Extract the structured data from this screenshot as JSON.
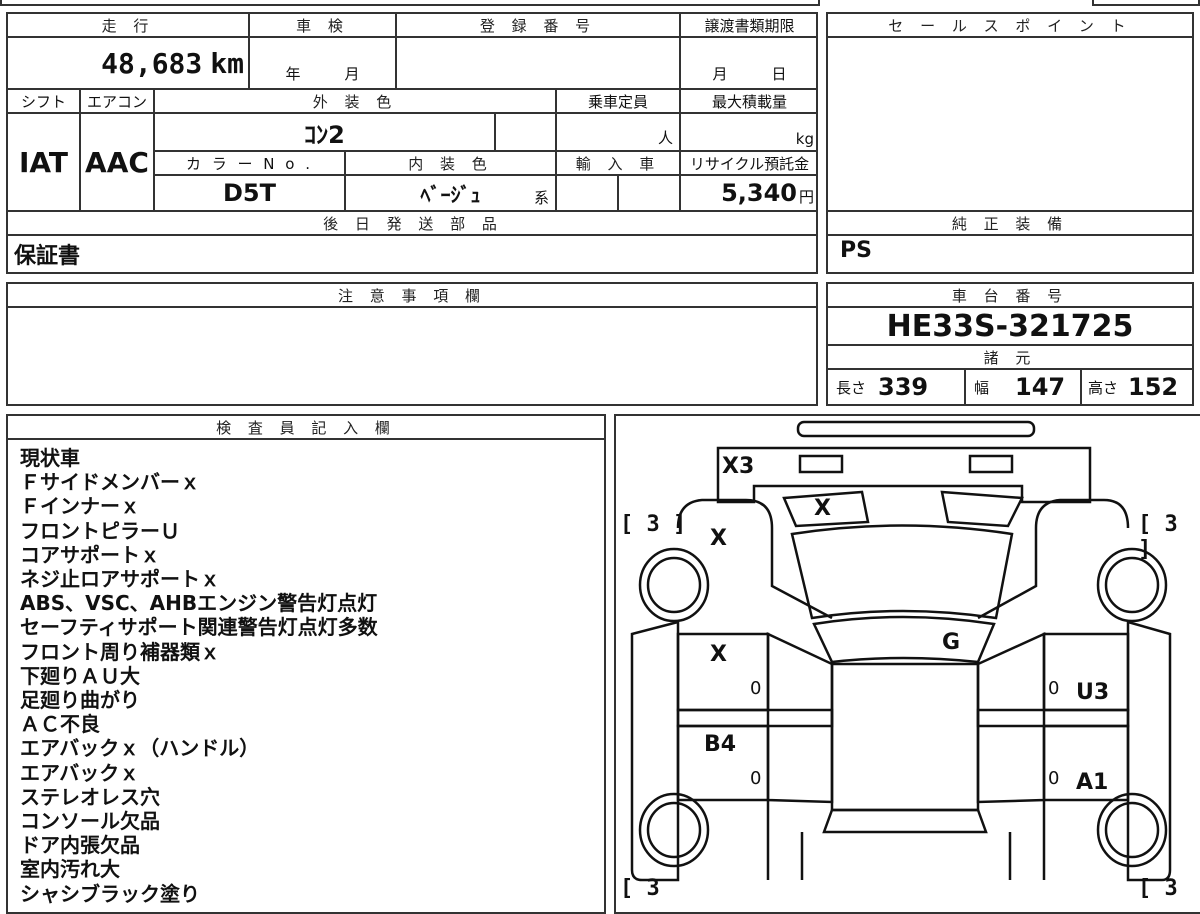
{
  "top_info": {
    "mileage_header": "走 行",
    "mileage_value": "48,683",
    "mileage_unit": "km",
    "inspection_header": "車 検",
    "inspection_year_label": "年",
    "inspection_month_label": "月",
    "registration_header": "登 録 番 号",
    "transfer_deadline_header": "譲渡書類期限",
    "transfer_month_label": "月",
    "transfer_day_label": "日"
  },
  "specs": {
    "shift_header": "シフト",
    "shift_value": "IAT",
    "aircon_header": "エアコン",
    "aircon_value": "AAC",
    "exterior_color_header": "外 装 色",
    "exterior_color_value": "ｺﾝ2",
    "capacity_header": "乗車定員",
    "capacity_unit": "人",
    "max_load_header": "最大積載量",
    "max_load_unit": "kg",
    "color_no_header": "カ ラ ー N o .",
    "color_no_value": "D5T",
    "interior_color_header": "内 装 色",
    "interior_color_value": "ﾍﾞｰｼﾞｭ",
    "interior_color_suffix": "系",
    "import_header": "輸 入 車",
    "recycle_header": "リサイクル預託金",
    "recycle_value": "5,340",
    "recycle_unit": "円"
  },
  "later_parts": {
    "header": "後 日 発 送 部 品",
    "value": "保証書"
  },
  "sales_points": {
    "header": "セ ー ル ス ポ イ ン ト"
  },
  "genuine_equipment": {
    "header": "純 正 装 備",
    "value": "PS"
  },
  "notes": {
    "header": "注 意 事 項 欄"
  },
  "chassis": {
    "header": "車 台 番 号",
    "value": "HE33S-321725",
    "dimensions_header": "諸 元",
    "length_label": "長さ",
    "length_value": "339",
    "width_label": "幅",
    "width_value": "147",
    "height_label": "高さ",
    "height_value": "152"
  },
  "inspector": {
    "header": "検 査 員 記 入 欄",
    "lines": [
      "現状車",
      "Ｆサイドメンバーｘ",
      "Ｆインナーｘ",
      "フロントピラーＵ",
      "コアサポートｘ",
      "ネジ止ロアサポートｘ",
      "ABS、VSC、AHBエンジン警告灯点灯",
      "セーフティサポート関連警告灯点灯多数",
      "フロント周り補器類ｘ",
      "下廻りＡＵ大",
      "足廻り曲がり",
      "ＡＣ不良",
      "エアバックｘ（ハンドル）",
      "エアバックｘ",
      "ステレオレス穴",
      "コンソール欠品",
      "ドア内張欠品",
      "室内汚れ大",
      "シャシブラック塗り"
    ]
  },
  "diagram": {
    "marks": {
      "front_bumper": "X3",
      "hood_front": "X",
      "left_fender": "X",
      "left_front_door": "X",
      "roof": "G",
      "right_front_door": "U3",
      "left_rear_door": "B4",
      "right_rear_door": "A1"
    },
    "tire_tl": "[ 3 ]",
    "tire_tr": "[ 3 ]",
    "tire_bl": "[ 3",
    "tire_br": "[ 3",
    "door_zero": "0"
  }
}
